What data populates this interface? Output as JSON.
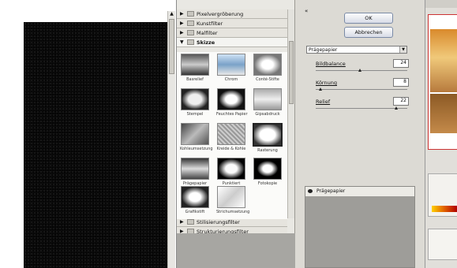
{
  "gallery": {
    "categories_top": [
      {
        "label": "Pixelvergröberung"
      },
      {
        "label": "Kunstfilter"
      },
      {
        "label": "Malfilter"
      }
    ],
    "open_category": {
      "label": "Skizze"
    },
    "thumbnails": [
      {
        "label": "Basrelief"
      },
      {
        "label": "Chrom"
      },
      {
        "label": "Conté-Stifte"
      },
      {
        "label": "Stempel"
      },
      {
        "label": "Feuchtes Papier"
      },
      {
        "label": "Gipsabdruck"
      },
      {
        "label": "Kohleumsetzung"
      },
      {
        "label": "Kreide & Kohle"
      },
      {
        "label": "Rasterung"
      },
      {
        "label": "Prägepapier"
      },
      {
        "label": "Punktiert"
      },
      {
        "label": "Fotokopie"
      },
      {
        "label": "Grafikstift"
      },
      {
        "label": "Strichumsetzung"
      }
    ],
    "categories_bottom": [
      {
        "label": "Stilisierungsfilter"
      },
      {
        "label": "Strukturierungsfilter"
      }
    ]
  },
  "settings": {
    "ok_label": "OK",
    "cancel_label": "Abbrechen",
    "filter_select": "Prägepapier",
    "params": [
      {
        "label": "Bildbalance",
        "value": "24",
        "fraction": 0.48
      },
      {
        "label": "Körnung",
        "value": "8",
        "fraction": 0.05
      },
      {
        "label": "Relief",
        "value": "22",
        "fraction": 0.88
      }
    ],
    "layer_name": "Prägepapier"
  }
}
